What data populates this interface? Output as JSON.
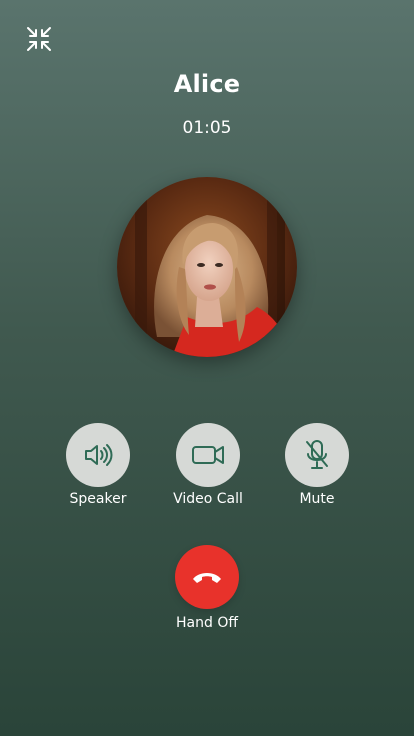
{
  "call": {
    "name": "Alice",
    "duration": "01:05"
  },
  "controls": {
    "speaker_label": "Speaker",
    "video_label": "Video Call",
    "mute_label": "Mute",
    "hangup_label": "Hand Off"
  },
  "icons": {
    "minimize": "minimize-icon",
    "speaker": "speaker-icon",
    "video": "video-camera-icon",
    "mute": "microphone-off-icon",
    "hangup": "phone-hangup-icon"
  },
  "colors": {
    "background_top": "#5a746d",
    "background_bottom": "#2a4439",
    "control_bg": "#d6d9d6",
    "control_icon": "#2f6b56",
    "hangup_bg": "#e8322b"
  }
}
